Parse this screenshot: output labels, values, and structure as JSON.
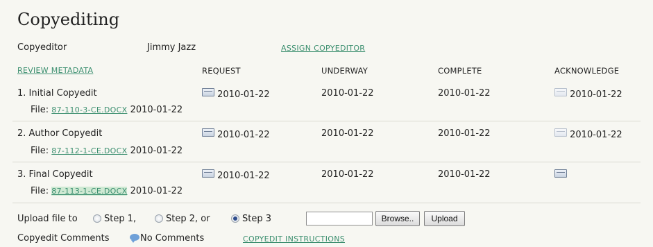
{
  "section_title": "Copyediting",
  "copyeditor": {
    "label": "Copyeditor",
    "name": "Jimmy Jazz",
    "assign_link": "ASSIGN COPYEDITOR"
  },
  "columns": {
    "review_metadata": "REVIEW METADATA",
    "request": "REQUEST",
    "underway": "UNDERWAY",
    "complete": "COMPLETE",
    "acknowledge": "ACKNOWLEDGE"
  },
  "steps": [
    {
      "label": "1. Initial Copyedit",
      "request": "2010-01-22",
      "underway": "2010-01-22",
      "complete": "2010-01-22",
      "acknowledge": "2010-01-22",
      "file_label": "File:",
      "file_name": "87-110-3-CE.DOCX",
      "file_date": "2010-01-22"
    },
    {
      "label": "2. Author Copyedit",
      "request": "2010-01-22",
      "underway": "2010-01-22",
      "complete": "2010-01-22",
      "acknowledge": "2010-01-22",
      "file_label": "File:",
      "file_name": "87-112-1-CE.DOCX",
      "file_date": "2010-01-22"
    },
    {
      "label": "3. Final Copyedit",
      "request": "2010-01-22",
      "underway": "2010-01-22",
      "complete": "2010-01-22",
      "acknowledge": "",
      "file_label": "File:",
      "file_name": "87-113-1-CE.DOCX",
      "file_date": "2010-01-22"
    }
  ],
  "upload": {
    "label": "Upload file to",
    "option1": "Step 1,",
    "option2": "Step 2, or",
    "option3": "Step 3",
    "selected": "Step 3",
    "browse_button": "Browse..",
    "upload_button": "Upload"
  },
  "comments": {
    "label": "Copyedit Comments",
    "status": "No Comments",
    "instructions_link": "COPYEDIT INSTRUCTIONS"
  },
  "icons": {
    "mail": "envelope-icon",
    "comment": "comment-bubble-icon"
  },
  "colors": {
    "link": "#3a8e6e",
    "background": "#f7f7f2",
    "highlight": "#cfe9d3"
  }
}
